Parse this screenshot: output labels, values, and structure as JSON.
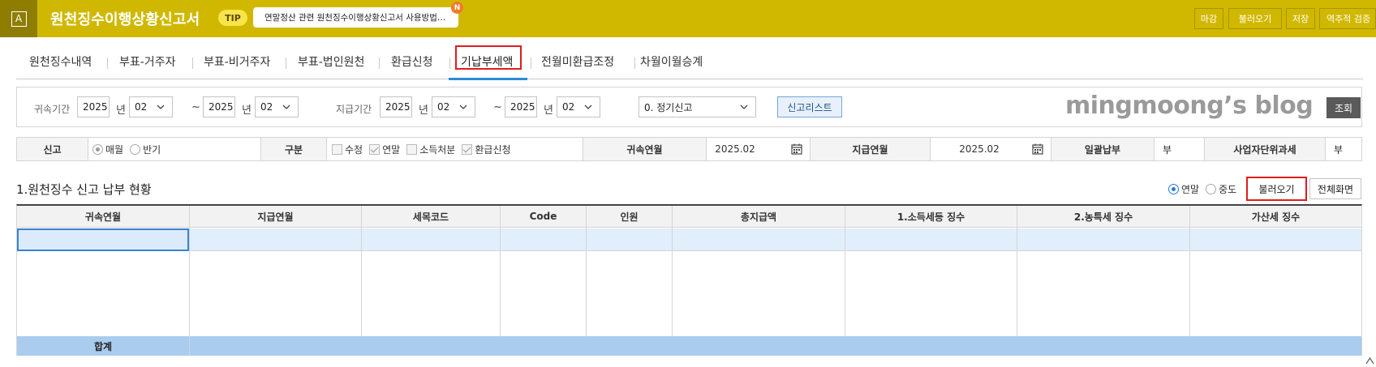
{
  "header": {
    "app_icon_letter": "A",
    "title": "원천징수이행상황신고서",
    "tip_label": "TIP",
    "tip_text": "연말정산 관련 원천징수이행상황신고서 사용방법…",
    "new_badge": "N",
    "buttons": [
      "마감",
      "불러오기",
      "저장",
      "역추적 검증"
    ]
  },
  "tabs": {
    "items": [
      "원천징수내역",
      "부표-거주자",
      "부표-비거주자",
      "부표-법인원천",
      "환급신청",
      "기납부세액",
      "전월미환급조정",
      "차월이월승계"
    ],
    "active": "기납부세액"
  },
  "filter": {
    "attribution_label": "귀속기간",
    "payment_label": "지급기간",
    "attr_from_year": "2025",
    "attr_from_month": "02",
    "attr_to_year": "2025",
    "attr_to_month": "02",
    "pay_from_year": "2025",
    "pay_from_month": "02",
    "pay_to_year": "2025",
    "pay_to_month": "02",
    "year_unit": "년",
    "tilde": "~",
    "report_type": "0. 정기신고",
    "report_list_button": "신고리스트",
    "watermark": "mingmoong’s blog",
    "query_button": "조회"
  },
  "info": {
    "report_label": "신고",
    "opt_monthly": "매월",
    "opt_half": "반기",
    "category_label": "구분",
    "opt_amend": "수정",
    "opt_yearend": "연말",
    "opt_income": "소득처분",
    "opt_refund": "환급신청",
    "attr_ym_label": "귀속연월",
    "attr_ym_value": "2025.02",
    "pay_ym_label": "지급연월",
    "pay_ym_value": "2025.02",
    "lump_label": "일괄납부",
    "lump_value": "부",
    "biz_label": "사업자단위과세",
    "biz_value": "부"
  },
  "section": {
    "title": "1.원천징수 신고 납부 현황",
    "opt_yearend": "연말",
    "opt_midyear": "중도",
    "load_button": "불러오기",
    "full_button": "전체화면"
  },
  "grid": {
    "columns": [
      "귀속연월",
      "지급연월",
      "세목코드",
      "Code",
      "인원",
      "총지급액",
      "1.소득세등 징수",
      "2.농특세 징수",
      "가산세 징수"
    ],
    "footer_label": "합계"
  },
  "colors": {
    "header_bg": "#d1b800",
    "accent_red": "#e01d1d",
    "accent_blue": "#2a8bd6",
    "grid_row": "#e1eefb",
    "grid_footer": "#a9ccef"
  }
}
